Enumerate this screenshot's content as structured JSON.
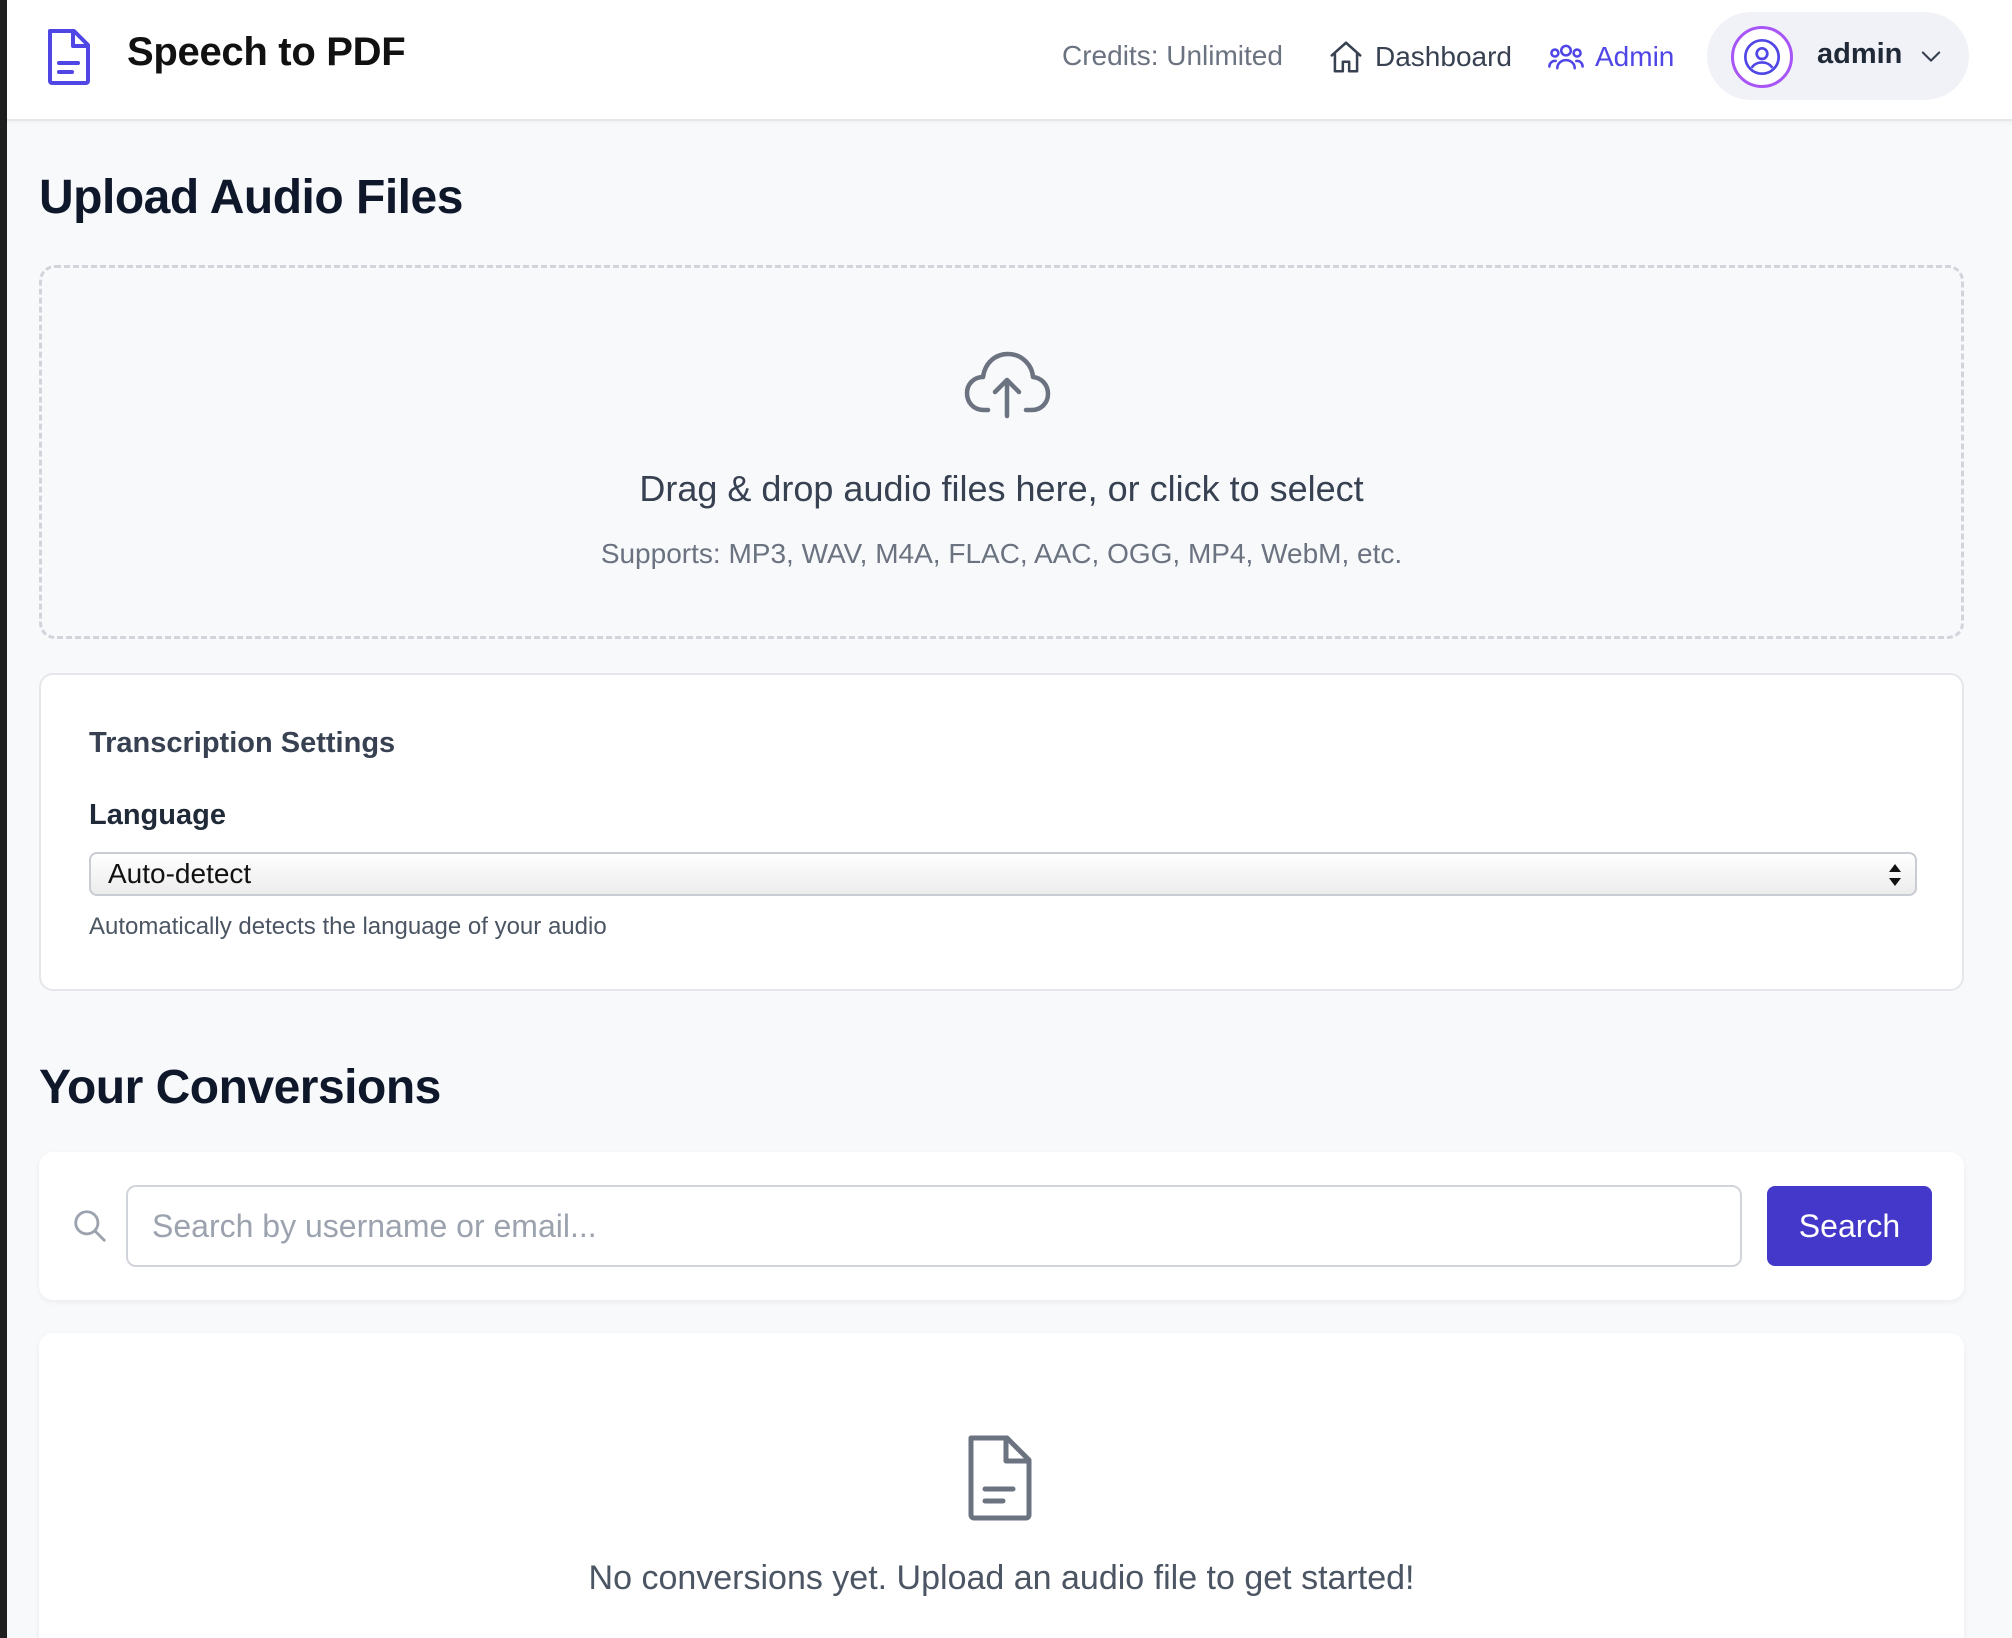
{
  "header": {
    "app_title": "Speech to PDF",
    "credits": "Credits: Unlimited",
    "nav": {
      "dashboard_label": "Dashboard",
      "admin_label": "Admin"
    },
    "user": {
      "name": "admin"
    }
  },
  "upload": {
    "heading": "Upload Audio Files",
    "dropzone_title": "Drag & drop audio files here, or click to select",
    "dropzone_subtitle": "Supports: MP3, WAV, M4A, FLAC, AAC, OGG, MP4, WebM, etc."
  },
  "settings": {
    "title": "Transcription Settings",
    "language_label": "Language",
    "language_selected": "Auto-detect",
    "language_help": "Automatically detects the language of your audio"
  },
  "conversions": {
    "heading": "Your Conversions",
    "search_placeholder": "Search by username or email...",
    "search_button": "Search",
    "empty_message": "No conversions yet. Upload an audio file to get started!"
  },
  "icons": {
    "brand": "document-icon",
    "dashboard": "home-icon",
    "admin": "users-icon",
    "user": "user-circle-icon",
    "dropdown": "chevron-down-icon",
    "upload": "cloud-upload-icon",
    "search": "search-icon",
    "empty": "document-icon"
  },
  "colors": {
    "accent": "#4f46e5",
    "button": "#4338ca",
    "avatar_ring": "#a855f7",
    "page_background": "#f8f9fb"
  }
}
